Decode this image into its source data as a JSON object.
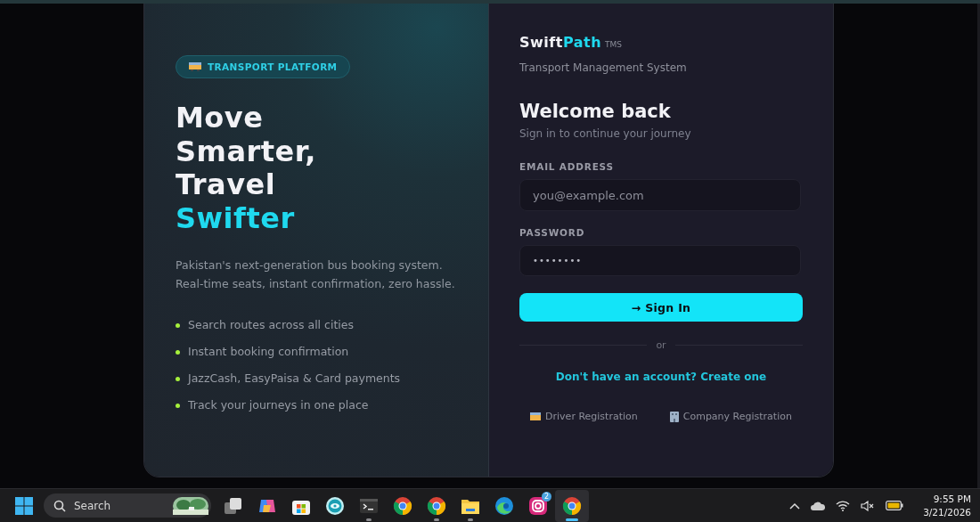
{
  "hero": {
    "badge": "TRANSPORT PLATFORM",
    "headline": [
      {
        "text": "Move",
        "accent": false
      },
      {
        "text": "Smarter,",
        "accent": false
      },
      {
        "text": "Travel",
        "accent": false
      },
      {
        "text": "Swifter",
        "accent": true
      }
    ],
    "description": "Pakistan's next-generation bus booking system. Real-time seats, instant confirmation, zero hassle.",
    "features": [
      "Search routes across all cities",
      "Instant booking confirmation",
      "JazzCash, EasyPaisa & Card payments",
      "Track your journeys in one place"
    ]
  },
  "brand": {
    "name_start": "Swift",
    "name_end": "Path",
    "suffix": "TMS",
    "tagline": "Transport Management System"
  },
  "login": {
    "title": "Welcome back",
    "subtitle": "Sign in to continue your journey",
    "fields": [
      {
        "label": "EMAIL ADDRESS",
        "placeholder": "you@example.com"
      },
      {
        "label": "PASSWORD",
        "value": "••••••••"
      }
    ],
    "submit": "→ Sign In",
    "divider": "or",
    "signup_link": "Don't have an account? Create one",
    "registrations": [
      {
        "kind": "driver",
        "label": "Driver Registration"
      },
      {
        "kind": "company",
        "label": "Company Registration"
      }
    ]
  },
  "taskbar": {
    "search_placeholder": "Search",
    "apps": [
      {
        "kind": "taskview",
        "running": false,
        "selected": false
      },
      {
        "kind": "copilot",
        "running": false,
        "selected": false
      },
      {
        "kind": "store",
        "running": false,
        "selected": false
      },
      {
        "kind": "eye",
        "running": false,
        "selected": false
      },
      {
        "kind": "terminal",
        "running": true,
        "selected": false
      },
      {
        "kind": "chrome",
        "running": false,
        "selected": false
      },
      {
        "kind": "chrome",
        "running": true,
        "selected": false
      },
      {
        "kind": "folder",
        "running": true,
        "selected": false
      },
      {
        "kind": "edge",
        "running": false,
        "selected": false
      },
      {
        "kind": "instagram",
        "running": false,
        "selected": false,
        "badge": "2"
      },
      {
        "kind": "chrome",
        "running": true,
        "selected": true
      }
    ],
    "time": "9:55 PM",
    "date": "3/21/2026"
  }
}
